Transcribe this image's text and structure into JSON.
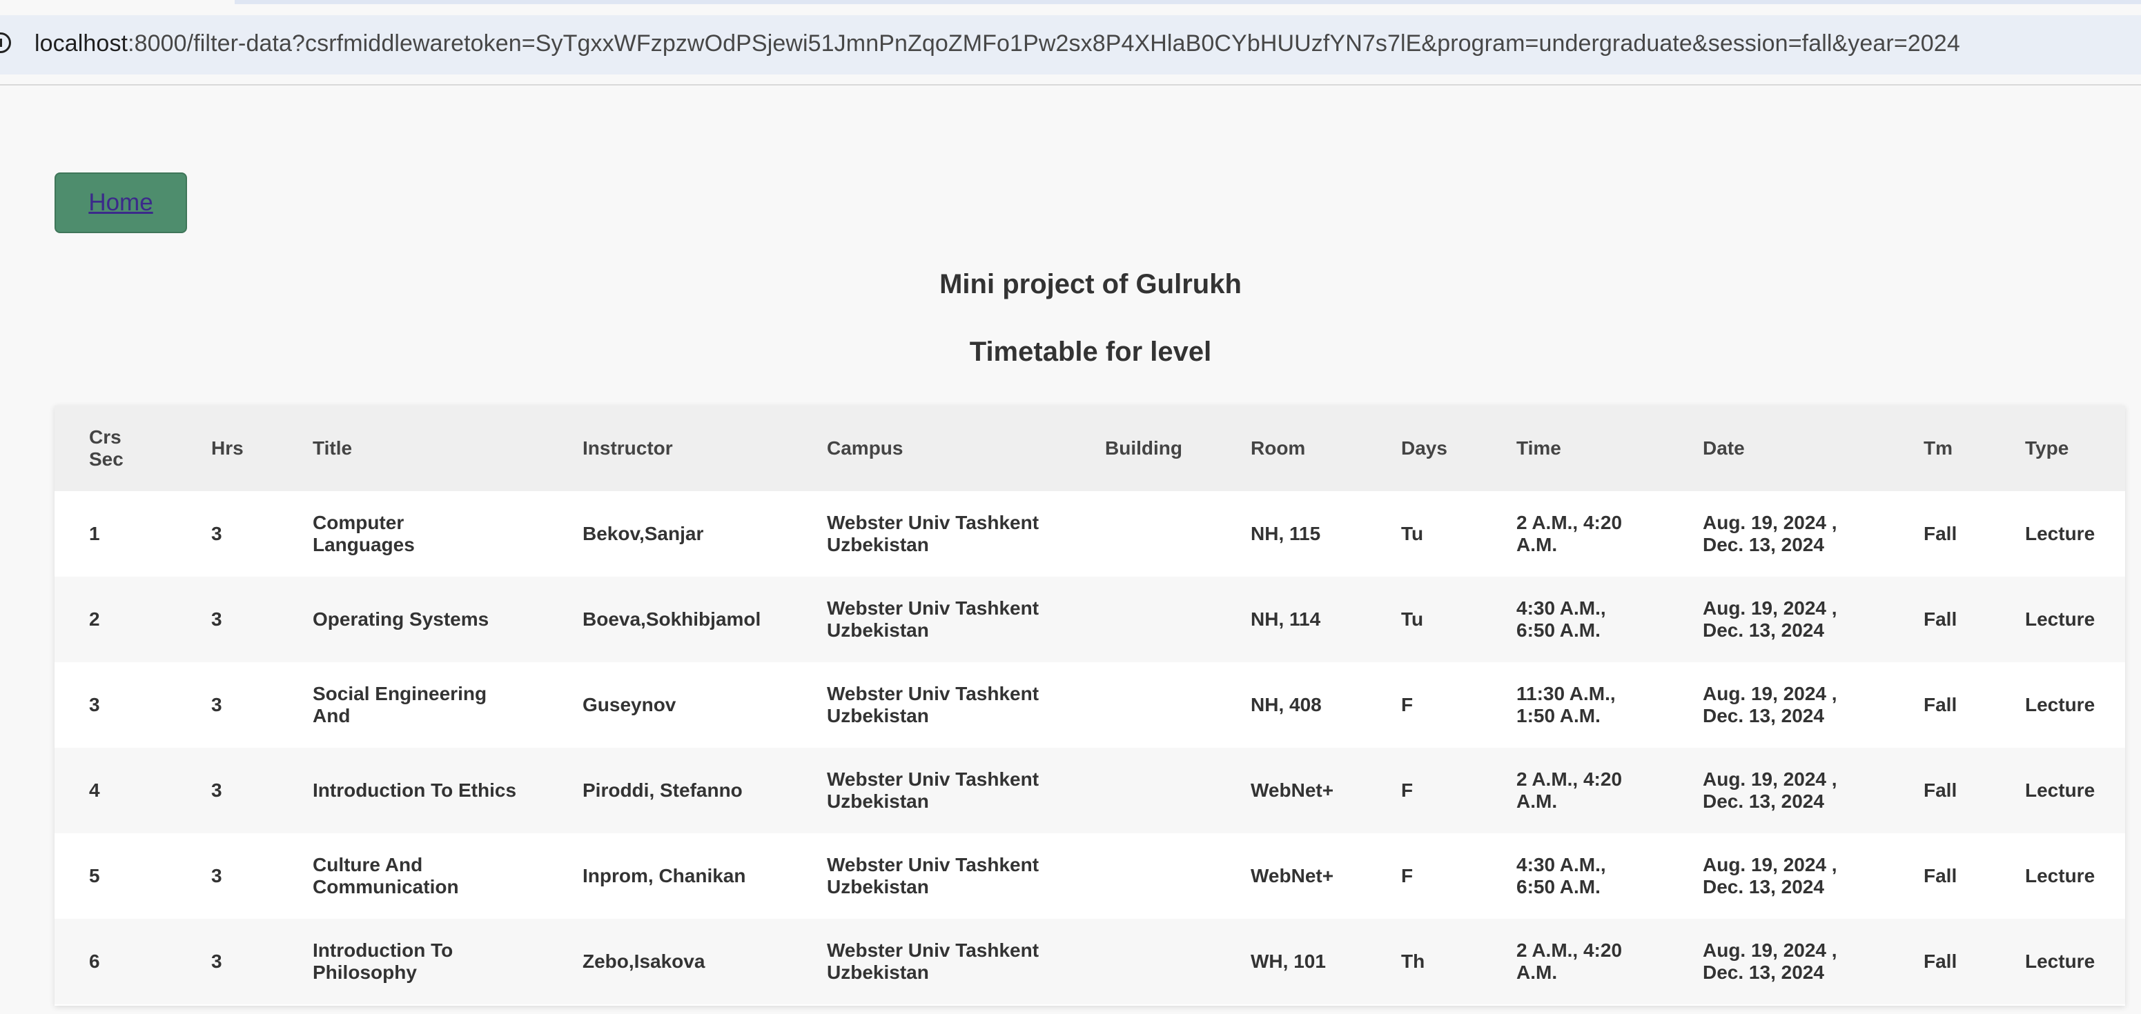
{
  "browser": {
    "url_host": "localhost",
    "url_rest": ":8000/filter-data?csrfmiddlewaretoken=SyTgxxWFzpzwOdPSjewi51JmnPnZqoZMFo1Pw2sx8P4XHlaB0CYbHUUzfYN7s7lE&program=undergraduate&session=fall&year=2024",
    "site_info_icon": "info-circle-icon"
  },
  "nav": {
    "home_label": "Home"
  },
  "header": {
    "title": "Mini project of Gulrukh",
    "subtitle": "Timetable for level"
  },
  "colors": {
    "home_button_bg": "#4e8d6d",
    "home_link": "#3b2a8a",
    "table_header_bg": "#efefef",
    "row_alt_bg": "#f7f7f7",
    "page_bg": "#f8f8f8"
  },
  "table": {
    "columns": [
      "Crs Sec",
      "Hrs",
      "Title",
      "Instructor",
      "Campus",
      "Building",
      "Room",
      "Days",
      "Time",
      "Date",
      "Tm",
      "Type"
    ],
    "rows": [
      [
        "1",
        "3",
        "Computer Languages",
        "Bekov,Sanjar",
        "Webster Univ Tashkent Uzbekistan",
        "",
        "NH, 115",
        "Tu",
        "2 A.M., 4:20 A.M.",
        "Aug. 19, 2024 , Dec. 13, 2024",
        "Fall",
        "Lecture"
      ],
      [
        "2",
        "3",
        "Operating Systems",
        "Boeva,Sokhibjamol",
        "Webster Univ Tashkent Uzbekistan",
        "",
        "NH, 114",
        "Tu",
        "4:30 A.M., 6:50 A.M.",
        "Aug. 19, 2024 , Dec. 13, 2024",
        "Fall",
        "Lecture"
      ],
      [
        "3",
        "3",
        "Social Engineering And",
        "Guseynov",
        "Webster Univ Tashkent Uzbekistan",
        "",
        "NH, 408",
        "F",
        "11:30 A.M., 1:50 A.M.",
        "Aug. 19, 2024 , Dec. 13, 2024",
        "Fall",
        "Lecture"
      ],
      [
        "4",
        "3",
        "Introduction To Ethics",
        "Piroddi, Stefanno",
        "Webster Univ Tashkent Uzbekistan",
        "",
        "WebNet+",
        "F",
        "2 A.M., 4:20 A.M.",
        "Aug. 19, 2024 , Dec. 13, 2024",
        "Fall",
        "Lecture"
      ],
      [
        "5",
        "3",
        "Culture And Communication",
        "Inprom, Chanikan",
        "Webster Univ Tashkent Uzbekistan",
        "",
        "WebNet+",
        "F",
        "4:30 A.M., 6:50 A.M.",
        "Aug. 19, 2024 , Dec. 13, 2024",
        "Fall",
        "Lecture"
      ],
      [
        "6",
        "3",
        "Introduction To Philosophy",
        "Zebo,Isakova",
        "Webster Univ Tashkent Uzbekistan",
        "",
        "WH, 101",
        "Th",
        "2 A.M., 4:20 A.M.",
        "Aug. 19, 2024 , Dec. 13, 2024",
        "Fall",
        "Lecture"
      ]
    ]
  }
}
